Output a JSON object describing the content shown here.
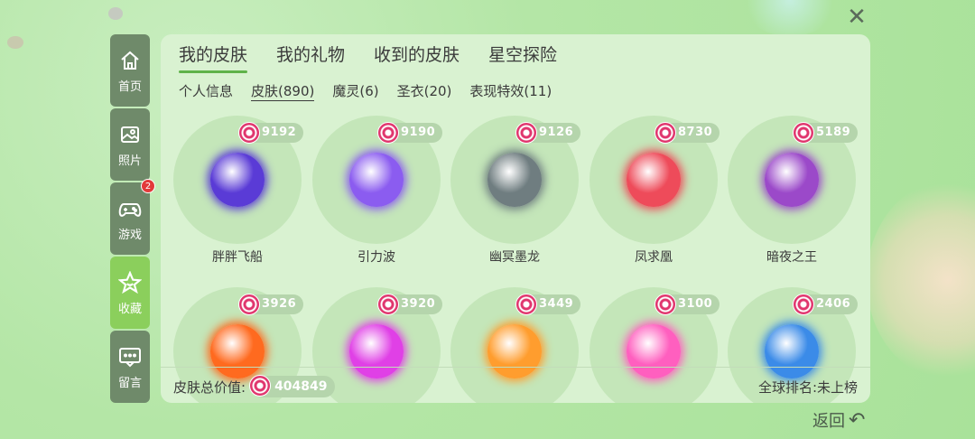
{
  "close_icon": "close-icon",
  "sidebar": {
    "items": [
      {
        "label": "首页",
        "icon": "home-icon"
      },
      {
        "label": "照片",
        "icon": "photo-icon"
      },
      {
        "label": "游戏",
        "icon": "gamepad-icon",
        "badge": "2"
      },
      {
        "label": "收藏",
        "icon": "star-icon"
      },
      {
        "label": "留言",
        "icon": "message-icon"
      }
    ],
    "active_index": 3
  },
  "tabs": [
    "我的皮肤",
    "我的礼物",
    "收到的皮肤",
    "星空探险"
  ],
  "subtabs": [
    "个人信息",
    "皮肤(890)",
    "魔灵(6)",
    "圣衣(20)",
    "表现特效(11)"
  ],
  "skins": [
    {
      "name": "胖胖飞船",
      "value": "9192",
      "color": "#5a3bd6"
    },
    {
      "name": "引力波",
      "value": "9190",
      "color": "#8b5cf0"
    },
    {
      "name": "幽冥墨龙",
      "value": "9126",
      "color": "#6f7d80"
    },
    {
      "name": "凤求凰",
      "value": "8730",
      "color": "#ee4b5a"
    },
    {
      "name": "暗夜之王",
      "value": "5189",
      "color": "#9b49c9"
    },
    {
      "name": "",
      "value": "3926",
      "color": "#ff6a1f"
    },
    {
      "name": "",
      "value": "3920",
      "color": "#e040e6"
    },
    {
      "name": "",
      "value": "3449",
      "color": "#ff9d2e"
    },
    {
      "name": "",
      "value": "3100",
      "color": "#ff5fbf"
    },
    {
      "name": "",
      "value": "2406",
      "color": "#3b8be8"
    }
  ],
  "footer": {
    "total_label": "皮肤总价值:",
    "total_value": "404849",
    "rank_text": "全球排名:未上榜"
  },
  "back_label": "返回"
}
